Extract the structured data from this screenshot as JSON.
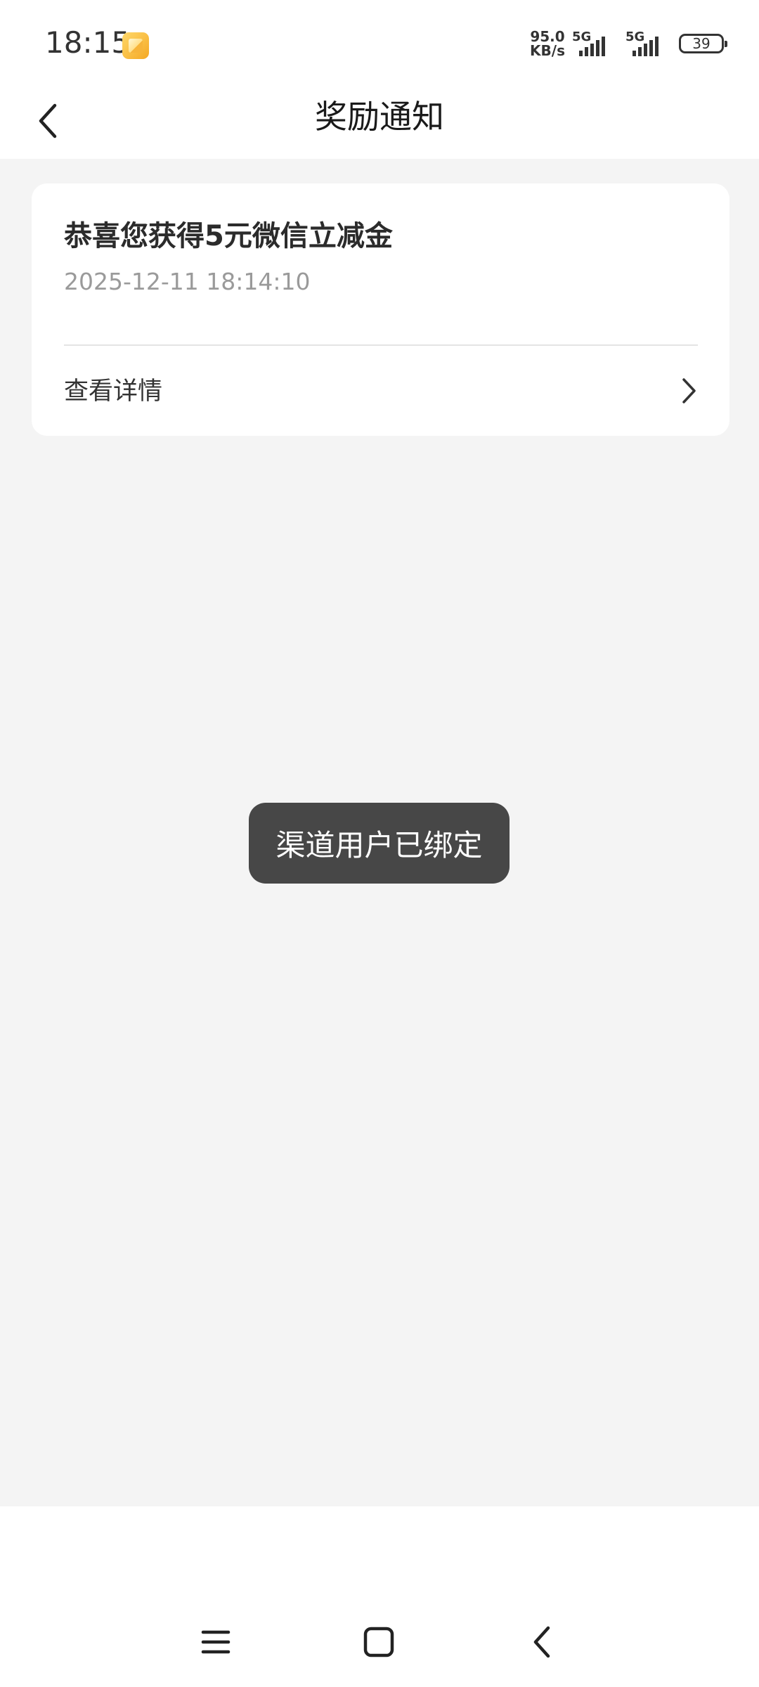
{
  "status_bar": {
    "time": "18:15",
    "app_icon": "notes-app-icon",
    "net_speed_value": "95.0",
    "net_speed_unit": "KB/s",
    "sim1_label": "5G",
    "sim2_label": "5G",
    "battery": "39"
  },
  "header": {
    "back_icon": "chevron-left-icon",
    "title": "奖励通知"
  },
  "notification": {
    "title": "恭喜您获得5元微信立减金",
    "timestamp": "2025-12-11 18:14:10",
    "link_label": "查看详情",
    "link_icon": "chevron-right-icon"
  },
  "toast": {
    "message": "渠道用户已绑定"
  },
  "nav_bar": {
    "menu_icon": "menu-icon",
    "home_icon": "home-square-icon",
    "back_icon": "back-triangle-icon"
  },
  "colors": {
    "page_background": "#f4f4f4",
    "card_background": "#ffffff",
    "toast_background": "#474747",
    "secondary_text": "#9a9a9a"
  }
}
